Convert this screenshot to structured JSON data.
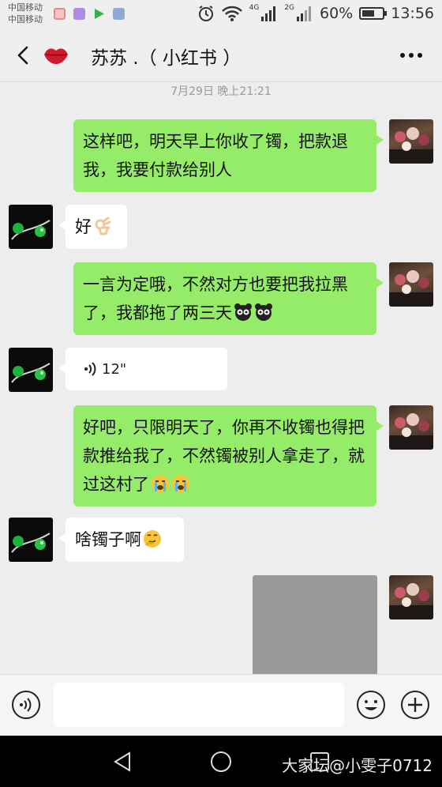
{
  "status_bar": {
    "carrier_1": "中国移动",
    "carrier_2": "中国移动",
    "net_1": "4G",
    "net_2": "2G",
    "battery_text": "60%",
    "battery_level": 0.6,
    "time": "13:56",
    "left_icons": [
      "calendar-icon",
      "gallery-icon",
      "play-icon",
      "app-icon"
    ]
  },
  "header": {
    "title": "苏苏 .（ 小红书 ）",
    "back_icon": "back-arrow-icon",
    "avatar_icon": "lips-icon",
    "more_icon": "more-icon"
  },
  "chat": {
    "timestamp": "7月29日 晚上21:21",
    "messages": [
      {
        "side": "me",
        "text": "这样吧，明天早上你收了镯，把款退我，我要付款给别人"
      },
      {
        "side": "other",
        "text": "好",
        "emoji": "ok-hand-emoji"
      },
      {
        "side": "me",
        "text": "一言为定哦，不然对方也要把我拉黑了，我都拖了两三天",
        "emoji": "panda-face-emoji x2"
      },
      {
        "side": "other",
        "type": "voice",
        "duration": "12\""
      },
      {
        "side": "me",
        "text": "好吧，只限明天了，你再不收镯也得把款推给我了，不然镯被别人拿走了，就过这村了",
        "emoji": "crying-face-emoji x2"
      },
      {
        "side": "other",
        "text": "啥镯子啊",
        "emoji": "thinking-face-emoji"
      },
      {
        "side": "me",
        "type": "image"
      }
    ]
  },
  "input_bar": {
    "voice_icon": "voice-input-icon",
    "emoji_icon": "smiley-icon",
    "plus_icon": "plus-icon",
    "value": ""
  },
  "nav_bar": {
    "icons": [
      "nav-back-icon",
      "nav-home-icon",
      "nav-recent-icon"
    ],
    "watermark": "大家坛@小雯子0712"
  },
  "colors": {
    "my_bubble": "#95ec69",
    "other_bubble": "#ffffff",
    "chat_bg": "#ededed"
  }
}
